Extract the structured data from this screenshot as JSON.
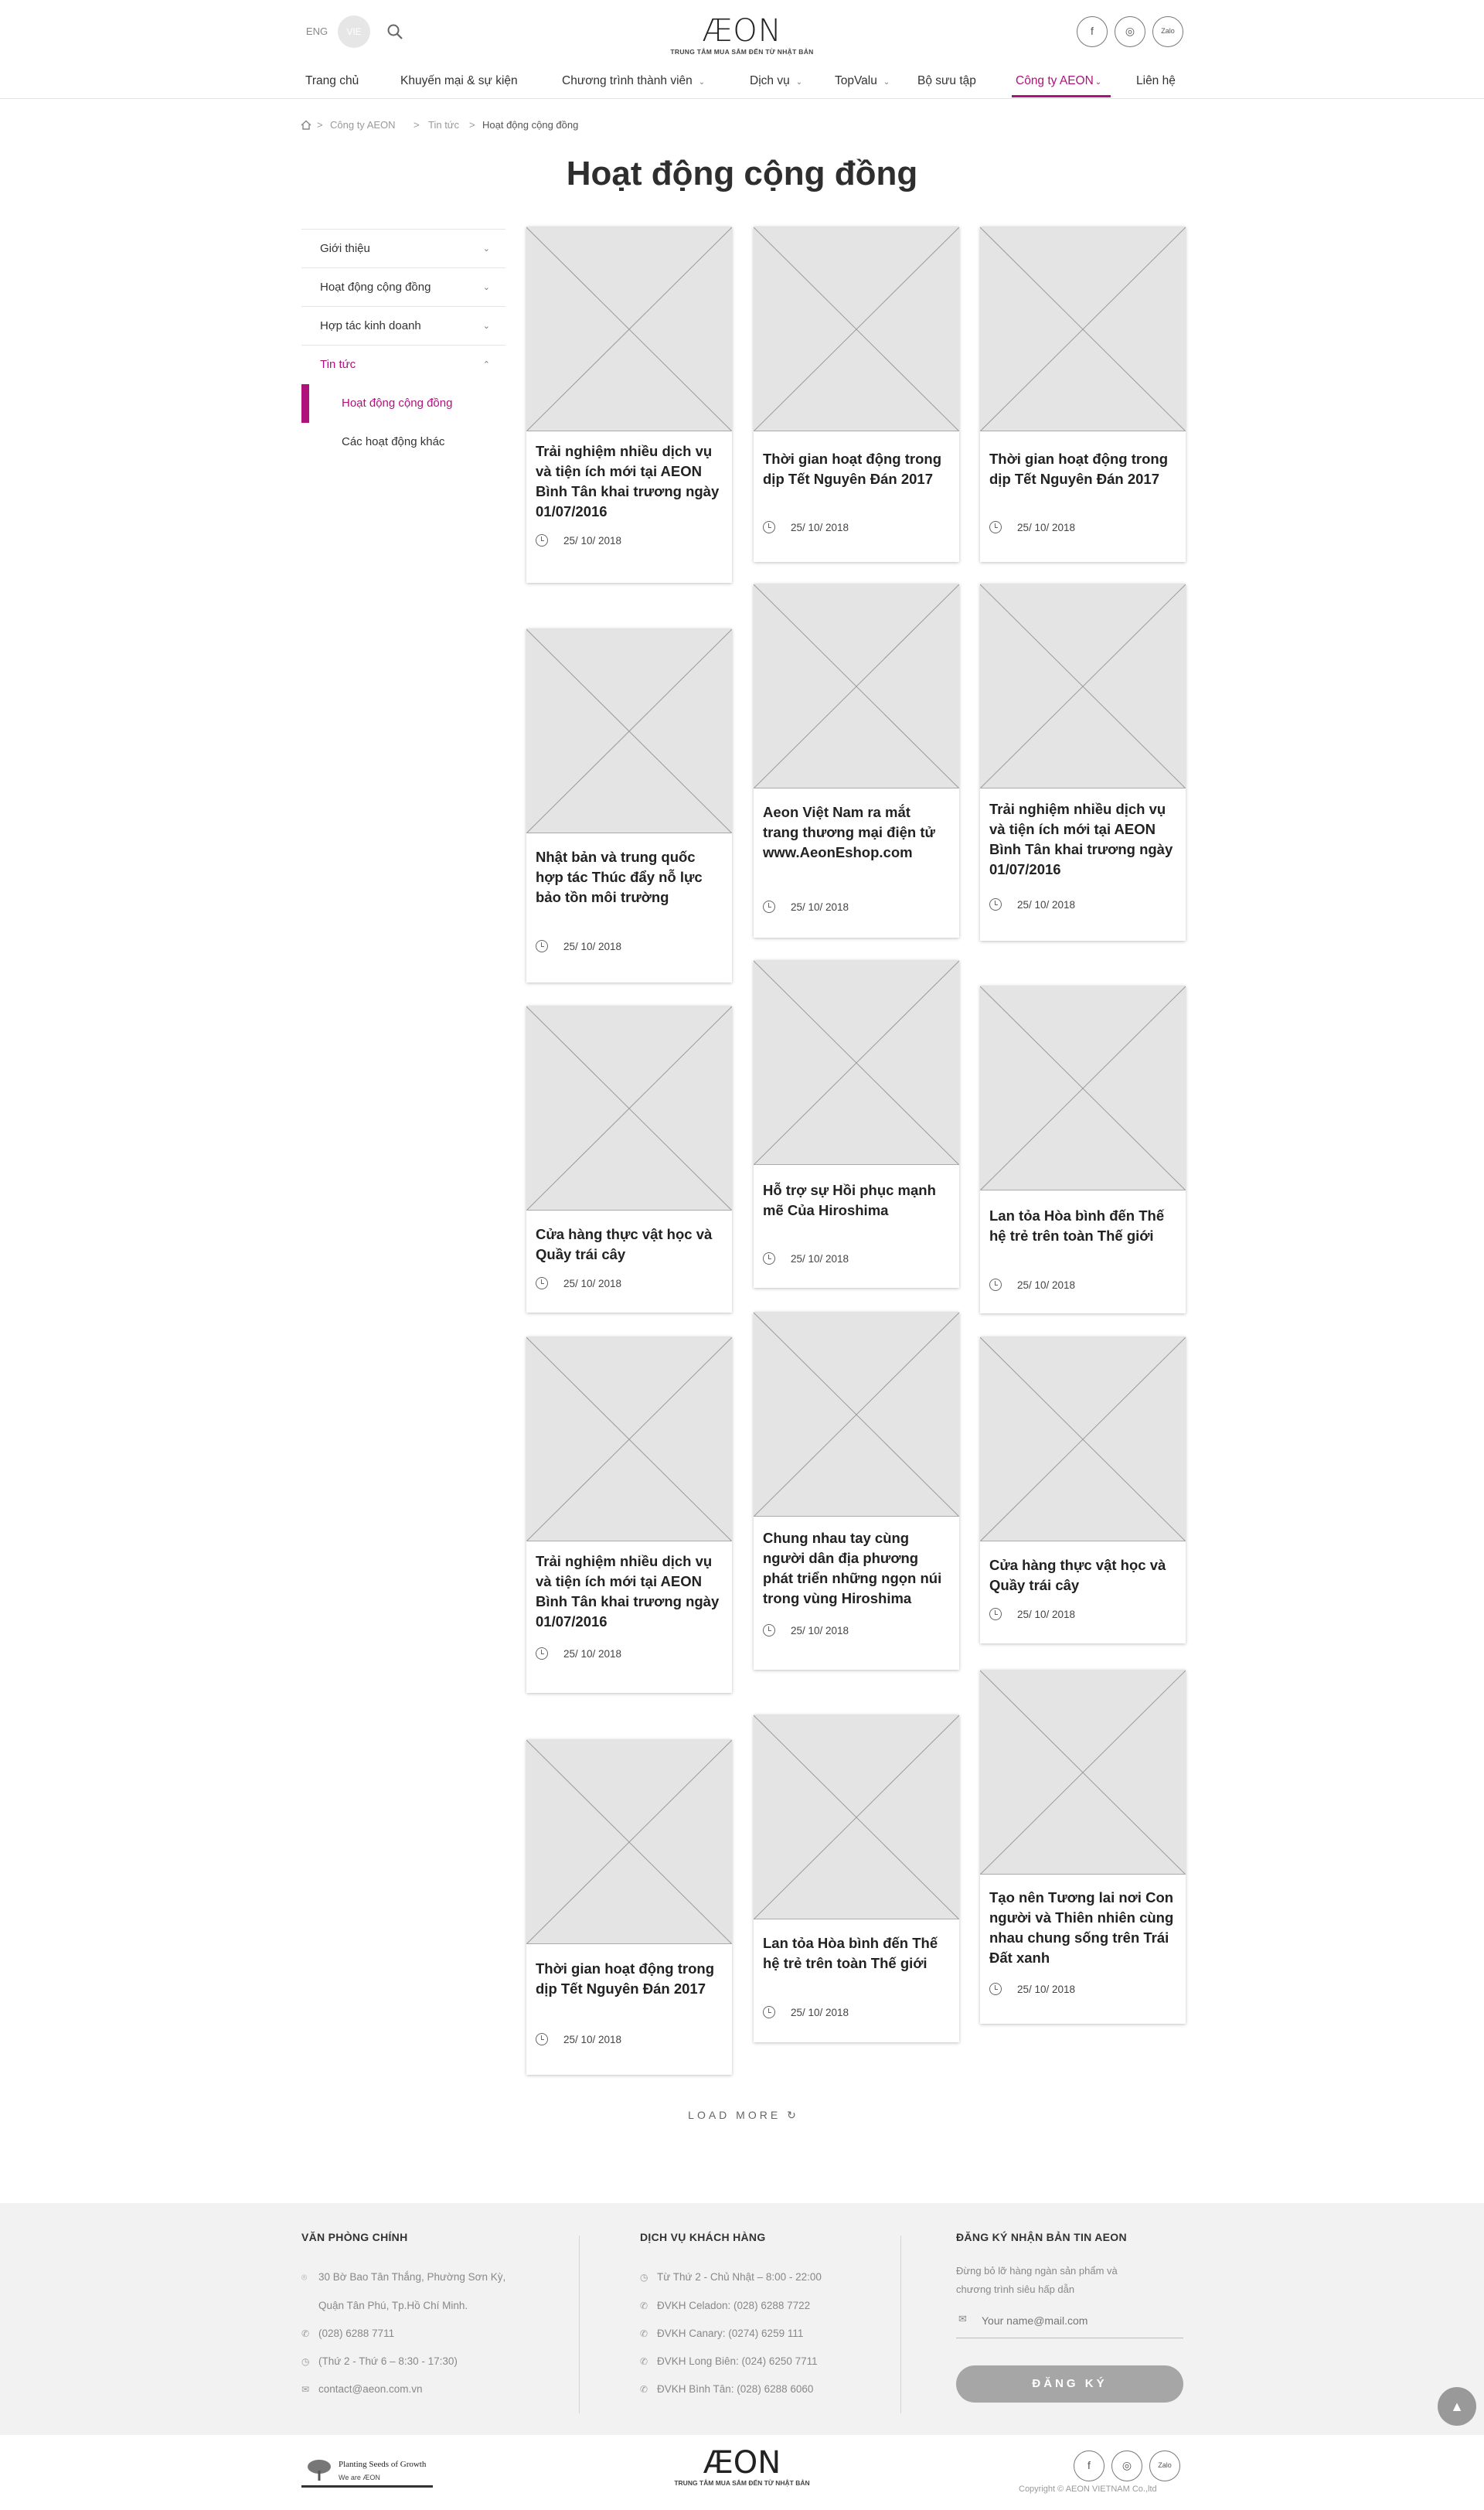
{
  "header": {
    "lang_eng": "ENG",
    "lang_vie": "VIE",
    "logo_text": "ÆON",
    "logo_tagline": "TRUNG TÂM MUA SẮM ĐẾN TỪ NHẬT BẢN",
    "social": [
      {
        "icon": "facebook-icon",
        "label": "f"
      },
      {
        "icon": "instagram-icon",
        "label": "◎"
      },
      {
        "icon": "zalo-icon",
        "label": "Zalo"
      }
    ],
    "nav": [
      {
        "label": "Trang chủ",
        "has_dropdown": false
      },
      {
        "label": "Khuyến mại & sự kiện",
        "has_dropdown": false
      },
      {
        "label": "Chương trình thành viên",
        "has_dropdown": true
      },
      {
        "label": "Dịch vụ",
        "has_dropdown": true
      },
      {
        "label": "TopValu",
        "has_dropdown": true
      },
      {
        "label": "Bộ sưu tập",
        "has_dropdown": false
      },
      {
        "label": "Công ty AEON",
        "has_dropdown": true,
        "active": true
      },
      {
        "label": "Liên hệ",
        "has_dropdown": false
      }
    ],
    "accent_color": "#b0127c"
  },
  "breadcrumb": {
    "home_icon": "home-icon",
    "items": [
      "Công ty AEON",
      "Tin tức",
      "Hoạt động cộng đồng"
    ],
    "separator": ">"
  },
  "page_title": "Hoạt động cộng đồng",
  "sidebar": {
    "items": [
      {
        "label": "Giới thiệu",
        "expanded": false
      },
      {
        "label": "Hoạt động cộng đồng",
        "expanded": false
      },
      {
        "label": "Hợp tác kinh doanh",
        "expanded": false
      },
      {
        "label": "Tin tức",
        "expanded": true,
        "active": true
      }
    ],
    "subitems": [
      {
        "label": "Hoạt động cộng đồng",
        "active": true
      },
      {
        "label": "Các hoạt động khác",
        "active": false
      }
    ]
  },
  "cards": [
    {
      "title": "Trải nghiệm nhiều dịch vụ và tiện ích mới tại AEON Bình Tân khai trương ngày 01/07/2016",
      "date": "25/ 10/ 2018"
    },
    {
      "title": "Thời gian hoạt động trong dịp Tết Nguyên Đán 2017",
      "date": "25/ 10/ 2018"
    },
    {
      "title": "Thời gian hoạt động trong dịp Tết Nguyên Đán 2017",
      "date": "25/ 10/ 2018"
    },
    {
      "title": "Nhật bản và trung quốc hợp tác Thúc đẩy nỗ lực bảo tồn môi trường",
      "date": "25/ 10/ 2018"
    },
    {
      "title": "Aeon Việt Nam ra mắt trang thương mại điện tử www.AeonEshop.com",
      "date": "25/ 10/ 2018"
    },
    {
      "title": "Trải nghiệm nhiều dịch vụ và tiện ích mới tại AEON Bình Tân khai trương ngày 01/07/2016",
      "date": "25/ 10/ 2018"
    },
    {
      "title": "Cửa hàng thực vật học và Quầy trái cây",
      "date": "25/ 10/ 2018"
    },
    {
      "title": "Hỗ trợ sự Hồi phục mạnh mẽ Của Hiroshima",
      "date": "25/ 10/ 2018"
    },
    {
      "title": "Lan tỏa Hòa bình đến Thế hệ trẻ trên toàn Thế giới",
      "date": "25/ 10/ 2018"
    },
    {
      "title": "Trải nghiệm nhiều dịch vụ và tiện ích mới tại AEON Bình Tân khai trương ngày 01/07/2016",
      "date": "25/ 10/ 2018"
    },
    {
      "title": "Chung nhau tay cùng người dân địa phương phát triển những ngọn núi trong vùng Hiroshima",
      "date": "25/ 10/ 2018"
    },
    {
      "title": "Cửa hàng thực vật học và Quầy trái cây",
      "date": "25/ 10/ 2018"
    },
    {
      "title": "Thời gian hoạt động trong dịp Tết Nguyên Đán 2017",
      "date": "25/ 10/ 2018"
    },
    {
      "title": "Lan tỏa Hòa bình đến Thế hệ trẻ trên toàn Thế giới",
      "date": "25/ 10/ 2018"
    },
    {
      "title": "Tạo nên Tương lai nơi Con người và Thiên nhiên cùng nhau chung sống trên Trái Đất xanh",
      "date": "25/ 10/ 2018"
    }
  ],
  "load_more": "LOAD MORE",
  "footer": {
    "office_heading": "VĂN PHÒNG CHÍNH",
    "office_lines": [
      {
        "icon": "location-icon",
        "text": "30 Bờ Bao Tân Thắng, Phường Sơn Kỳ,"
      },
      {
        "icon": "",
        "text": "Quận Tân Phú, Tp.Hồ Chí Minh."
      },
      {
        "icon": "phone-icon",
        "text": "(028) 6288 7711"
      },
      {
        "icon": "clock-icon",
        "text": "(Thứ 2 - Thứ 6 – 8:30 - 17:30)"
      },
      {
        "icon": "mail-icon",
        "text": "contact@aeon.com.vn"
      }
    ],
    "service_heading": "DỊCH VỤ KHÁCH HÀNG",
    "service_lines": [
      {
        "icon": "clock-icon",
        "text": "Từ Thứ 2 - Chủ Nhật – 8:00 - 22:00"
      },
      {
        "icon": "phone-icon",
        "text": "ĐVKH Celadon: (028) 6288 7722"
      },
      {
        "icon": "phone-icon",
        "text": "ĐVKH Canary: (0274) 6259 111"
      },
      {
        "icon": "phone-icon",
        "text": "ĐVKH Long Biên: (024) 6250 7711"
      },
      {
        "icon": "phone-icon",
        "text": "ĐVKH Bình Tân: (028) 6288 6060"
      }
    ],
    "newsletter_heading": "ĐĂNG KÝ NHẬN BẢN TIN AEON",
    "newsletter_desc_1": "Đừng bỏ lỡ hàng ngàn sản phẩm và",
    "newsletter_desc_2": "chương trình siêu hấp dẫn",
    "email_placeholder": "Your name@mail.com",
    "subscribe_label": "ĐĂNG KÝ",
    "to_top": "▲"
  },
  "bottom": {
    "psg_line1": "Planting Seeds of Growth",
    "psg_line2": "We are ÆON",
    "logo_text": "ÆON",
    "logo_tagline": "TRUNG TÂM MUA SẮM ĐẾN TỪ NHẬT BẢN",
    "copyright": "Copyright © AEON VIETNAM Co.,ltd"
  }
}
